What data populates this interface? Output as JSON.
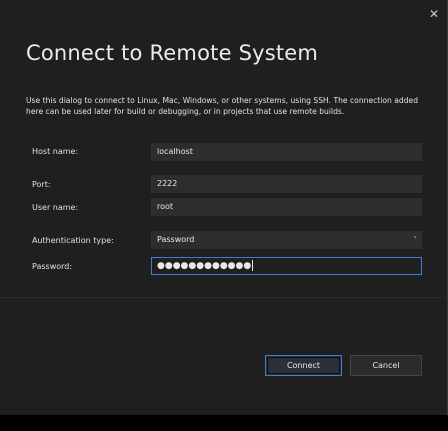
{
  "dialog": {
    "title": "Connect to Remote System",
    "description": "Use this dialog to connect to Linux, Mac, Windows, or other systems, using SSH. The connection added here can be used later for build or debugging, or in projects that use remote builds.",
    "close_glyph": "✕"
  },
  "form": {
    "host_label": "Host name:",
    "host_value": "localhost",
    "port_label": "Port:",
    "port_value": "2222",
    "user_label": "User name:",
    "user_value": "root",
    "auth_label": "Authentication type:",
    "auth_value": "Password",
    "auth_chevron": "˅",
    "password_label": "Password:",
    "password_masked": "●●●●●●●●●●●●"
  },
  "buttons": {
    "connect_label": "Connect",
    "cancel_label": "Cancel"
  },
  "colors": {
    "dialog_bg": "#1f1f1f",
    "field_bg": "#2d2d2d",
    "focus_accent": "#3c7fd6"
  }
}
